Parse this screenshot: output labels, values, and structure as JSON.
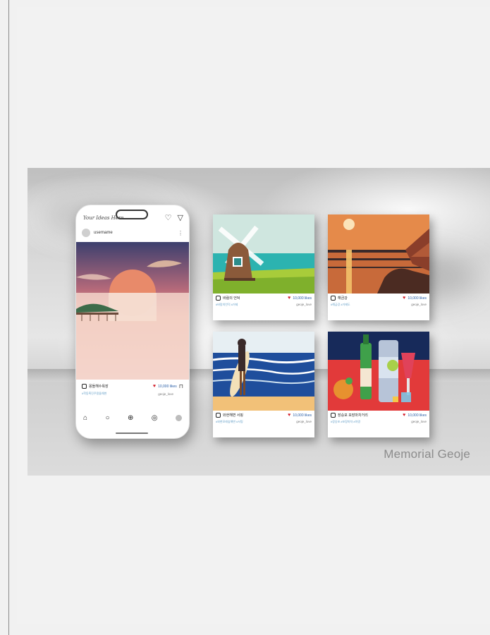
{
  "phone": {
    "brand": "Your Ideas Here",
    "username": "username",
    "place": "몽돌해수욕장",
    "likes": "10,000 likes",
    "link": "#학동흑진주몽돌해변",
    "tag": "geoje_love"
  },
  "cards": [
    {
      "place": "바람의 언덕",
      "likes": "10,000 likes",
      "link": "#바람의언덕 #거제",
      "tag": "geoje_love"
    },
    {
      "place": "해금강",
      "likes": "10,000 likes",
      "link": "#해금강 #거제도",
      "tag": "geoje_love"
    },
    {
      "place": "와현해변 서핑",
      "likes": "10,000 likes",
      "link": "#와현모래숲해변 #서핑",
      "tag": "geoje_love"
    },
    {
      "place": "장승포 포장마차거리",
      "likes": "10,000 likes",
      "link": "#장승포 #포장마차 #야경",
      "tag": "geoje_love"
    }
  ],
  "caption": "Memorial Geoje",
  "colors": {
    "heart": "#d21f2b",
    "likes": "#2a5fa8",
    "background": "#f2f2f2"
  }
}
